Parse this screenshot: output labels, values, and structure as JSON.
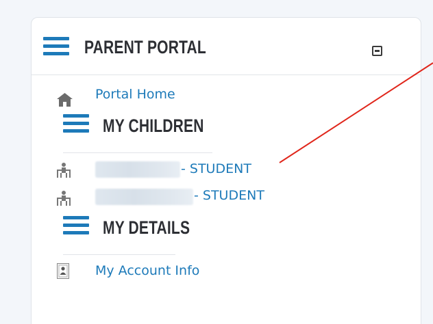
{
  "panel": {
    "title": "PARENT PORTAL",
    "collapse_label": "collapse"
  },
  "links": {
    "portal_home": "Portal Home",
    "my_account_info": "My Account Info"
  },
  "sections": {
    "my_children": "MY CHILDREN",
    "my_details": "MY DETAILS"
  },
  "children": [
    {
      "name_redacted": true,
      "suffix": "- STUDENT"
    },
    {
      "name_redacted": true,
      "suffix": "- STUDENT"
    }
  ],
  "colors": {
    "accent": "#1d7ab9",
    "heading": "#2d2f34",
    "annotation": "#e0261b"
  },
  "icons": [
    "hamburger-icon",
    "home-icon",
    "child-icon",
    "account-card-icon",
    "minimize-icon"
  ]
}
